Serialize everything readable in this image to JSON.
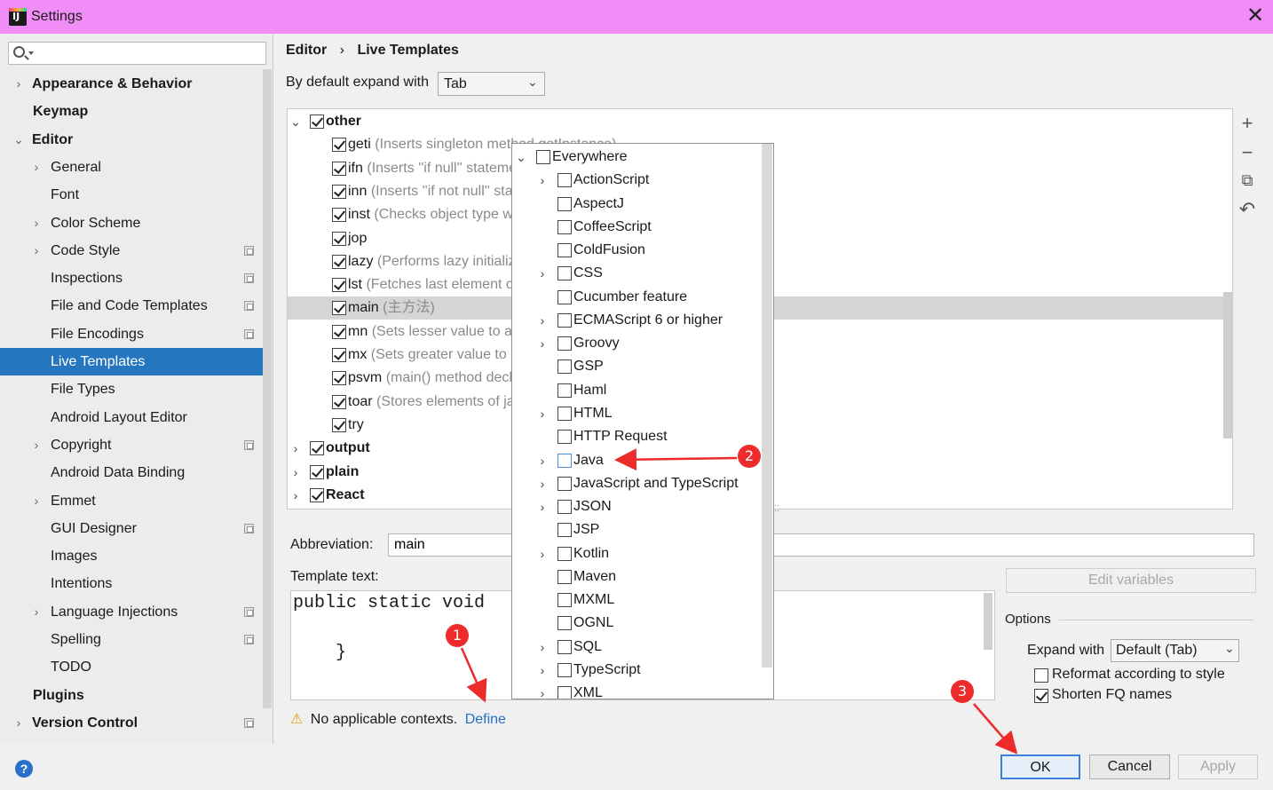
{
  "window": {
    "title": "Settings",
    "close_glyph": "✕"
  },
  "sidebar": {
    "search_placeholder": "",
    "items": [
      {
        "label": "Appearance & Behavior",
        "bold": true,
        "expander": "›"
      },
      {
        "label": "Keymap",
        "bold": true
      },
      {
        "label": "Editor",
        "bold": true,
        "expander": "⌄"
      },
      {
        "label": "General",
        "expander": "›"
      },
      {
        "label": "Font"
      },
      {
        "label": "Color Scheme",
        "expander": "›"
      },
      {
        "label": "Code Style",
        "expander": "›"
      },
      {
        "label": "Inspections"
      },
      {
        "label": "File and Code Templates"
      },
      {
        "label": "File Encodings"
      },
      {
        "label": "Live Templates"
      },
      {
        "label": "File Types"
      },
      {
        "label": "Android Layout Editor"
      },
      {
        "label": "Copyright",
        "expander": "›"
      },
      {
        "label": "Android Data Binding"
      },
      {
        "label": "Emmet",
        "expander": "›"
      },
      {
        "label": "GUI Designer"
      },
      {
        "label": "Images"
      },
      {
        "label": "Intentions"
      },
      {
        "label": "Language Injections",
        "expander": "›"
      },
      {
        "label": "Spelling"
      },
      {
        "label": "TODO"
      },
      {
        "label": "Plugins",
        "bold": true
      },
      {
        "label": "Version Control",
        "bold": true,
        "expander": "›"
      }
    ],
    "help_glyph": "?"
  },
  "breadcrumb": {
    "section": "Editor",
    "separator": "›",
    "page": "Live Templates"
  },
  "expand": {
    "label": "By default expand with",
    "value": "Tab"
  },
  "template_groups": {
    "other": {
      "name": "other",
      "expander": "⌄"
    },
    "templates": [
      {
        "abbr": "geti",
        "desc": "(Inserts singleton method getInstance)"
      },
      {
        "abbr": "ifn",
        "desc": "(Inserts ''if null'' statement)"
      },
      {
        "abbr": "inn",
        "desc": "(Inserts ''if not null'' statement)"
      },
      {
        "abbr": "inst",
        "desc": "(Checks object type with instanceof)"
      },
      {
        "abbr": "jop",
        "desc": ""
      },
      {
        "abbr": "lazy",
        "desc": "(Performs lazy initialization)"
      },
      {
        "abbr": "lst",
        "desc": "(Fetches last element of an array)"
      },
      {
        "abbr": "main",
        "desc": "(主方法)"
      },
      {
        "abbr": "mn",
        "desc": "(Sets lesser value to a variable)"
      },
      {
        "abbr": "mx",
        "desc": "(Sets greater value to a variable)"
      },
      {
        "abbr": "psvm",
        "desc": "(main() method declaration)"
      },
      {
        "abbr": "toar",
        "desc": "(Stores elements of java.util.Collection into array)"
      },
      {
        "abbr": "try",
        "desc": ""
      }
    ],
    "collapsed": [
      {
        "name": "output",
        "expander": "›"
      },
      {
        "name": "plain",
        "expander": "›"
      },
      {
        "name": "React",
        "expander": "›"
      }
    ]
  },
  "toolbar": {
    "add": "+",
    "remove": "−",
    "copy": "⧉",
    "restore": "↶"
  },
  "contexts_popup": {
    "root": {
      "label": "Everywhere",
      "expander": "⌄"
    },
    "items": [
      {
        "label": "ActionScript",
        "expander": "›"
      },
      {
        "label": "AspectJ"
      },
      {
        "label": "CoffeeScript"
      },
      {
        "label": "ColdFusion"
      },
      {
        "label": "CSS",
        "expander": "›"
      },
      {
        "label": "Cucumber feature"
      },
      {
        "label": "ECMAScript 6 or higher",
        "expander": "›"
      },
      {
        "label": "Groovy",
        "expander": "›"
      },
      {
        "label": "GSP"
      },
      {
        "label": "Haml"
      },
      {
        "label": "HTML",
        "expander": "›"
      },
      {
        "label": "HTTP Request"
      },
      {
        "label": "Java",
        "expander": "›"
      },
      {
        "label": "JavaScript and TypeScript",
        "expander": "›"
      },
      {
        "label": "JSON",
        "expander": "›"
      },
      {
        "label": "JSP"
      },
      {
        "label": "Kotlin",
        "expander": "›"
      },
      {
        "label": "Maven"
      },
      {
        "label": "MXML"
      },
      {
        "label": "OGNL"
      },
      {
        "label": "SQL",
        "expander": "›"
      },
      {
        "label": "TypeScript",
        "expander": "›"
      },
      {
        "label": "XML",
        "expander": "›"
      }
    ]
  },
  "abbreviation": {
    "label": "Abbreviation:",
    "value": "main"
  },
  "template_text": {
    "label": "Template text:",
    "line1": "public static void",
    "line2": "    }"
  },
  "edit_variables": {
    "label": "Edit variables"
  },
  "options": {
    "title": "Options",
    "expand_label": "Expand with",
    "expand_value": "Default (Tab)",
    "reformat_label": "Reformat according to style",
    "reformat_checked": false,
    "shorten_label": "Shorten FQ names",
    "shorten_checked": true
  },
  "warning": {
    "icon": "⚠",
    "text": "No applicable contexts.",
    "link": "Define"
  },
  "buttons": {
    "ok": "OK",
    "cancel": "Cancel",
    "apply": "Apply"
  },
  "annotations": {
    "marker1": "1",
    "marker2": "2",
    "marker3": "3",
    "accent": "#ee2b2b"
  }
}
